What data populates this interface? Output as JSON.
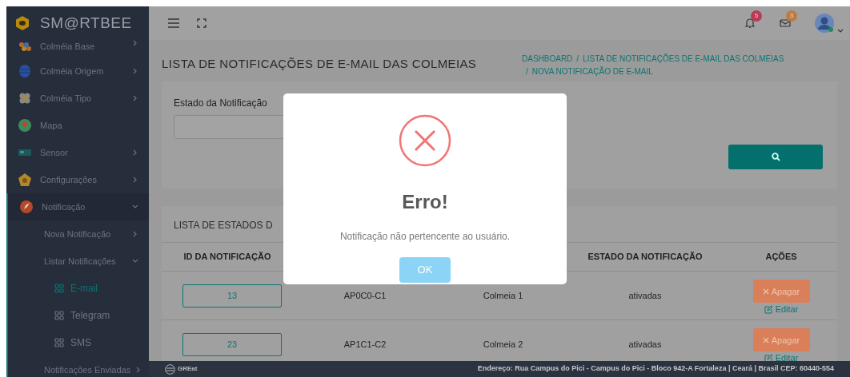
{
  "brand": "SM@RTBEE",
  "sidebar": {
    "items": [
      {
        "label": "Colméia Base",
        "expanded": false
      },
      {
        "label": "Colméia Origem",
        "expanded": false
      },
      {
        "label": "Colméia Tipo",
        "expanded": false
      },
      {
        "label": "Mapa"
      },
      {
        "label": "Sensor",
        "expanded": false
      },
      {
        "label": "Configurações",
        "expanded": false
      },
      {
        "label": "Notificação",
        "expanded": true,
        "children": [
          {
            "label": "Nova Notificação",
            "expanded": false
          },
          {
            "label": "Listar Notificações",
            "expanded": true,
            "children": [
              {
                "label": "E-mail",
                "selected": true
              },
              {
                "label": "Telegram",
                "selected": false
              },
              {
                "label": "SMS",
                "selected": false
              }
            ]
          },
          {
            "label": "Notificações Enviadas",
            "expanded": false
          }
        ]
      }
    ]
  },
  "header": {
    "notifications_badge": "5",
    "messages_badge": "3"
  },
  "page_title": "LISTA DE NOTIFICAÇÕES DE E-MAIL DAS COLMEIAS",
  "breadcrumb": [
    "DASHBOARD",
    "LISTA DE NOTIFICAÇÕES DE E-MAIL DAS COLMEIAS",
    "NOVA NOTIFICAÇÃO DE E-MAIL"
  ],
  "breadcrumb_separator": "/",
  "filter": {
    "label": "Estado da Notificação"
  },
  "table": {
    "title": "LISTA DE ESTADOS D",
    "columns": [
      "ID DA NOTIFICAÇÃO",
      null,
      null,
      "ESTADO DA NOTIFICAÇÃO",
      "AÇÕES"
    ],
    "rows": [
      {
        "id": "13",
        "column_2": "AP0C0-C1",
        "column_3": "Colmeia 1",
        "estado": "ativadas",
        "delete": "Apagar",
        "edit": "Editar"
      },
      {
        "id": "23",
        "column_2": "AP1C1-C2",
        "column_3": "Colmeia 2",
        "estado": "ativadas",
        "delete": "Apagar",
        "edit": "Editar"
      }
    ]
  },
  "footer": {
    "logo": "GREat",
    "address": "Endereço: Rua Campus do Pici - Campus do Pici - Bloco 942-A Fortaleza | Ceará | Brasil CEP: 60440-554"
  },
  "dialog": {
    "title": "Erro!",
    "message": "Notificação não pertencente ao usuário.",
    "button": "OK"
  }
}
